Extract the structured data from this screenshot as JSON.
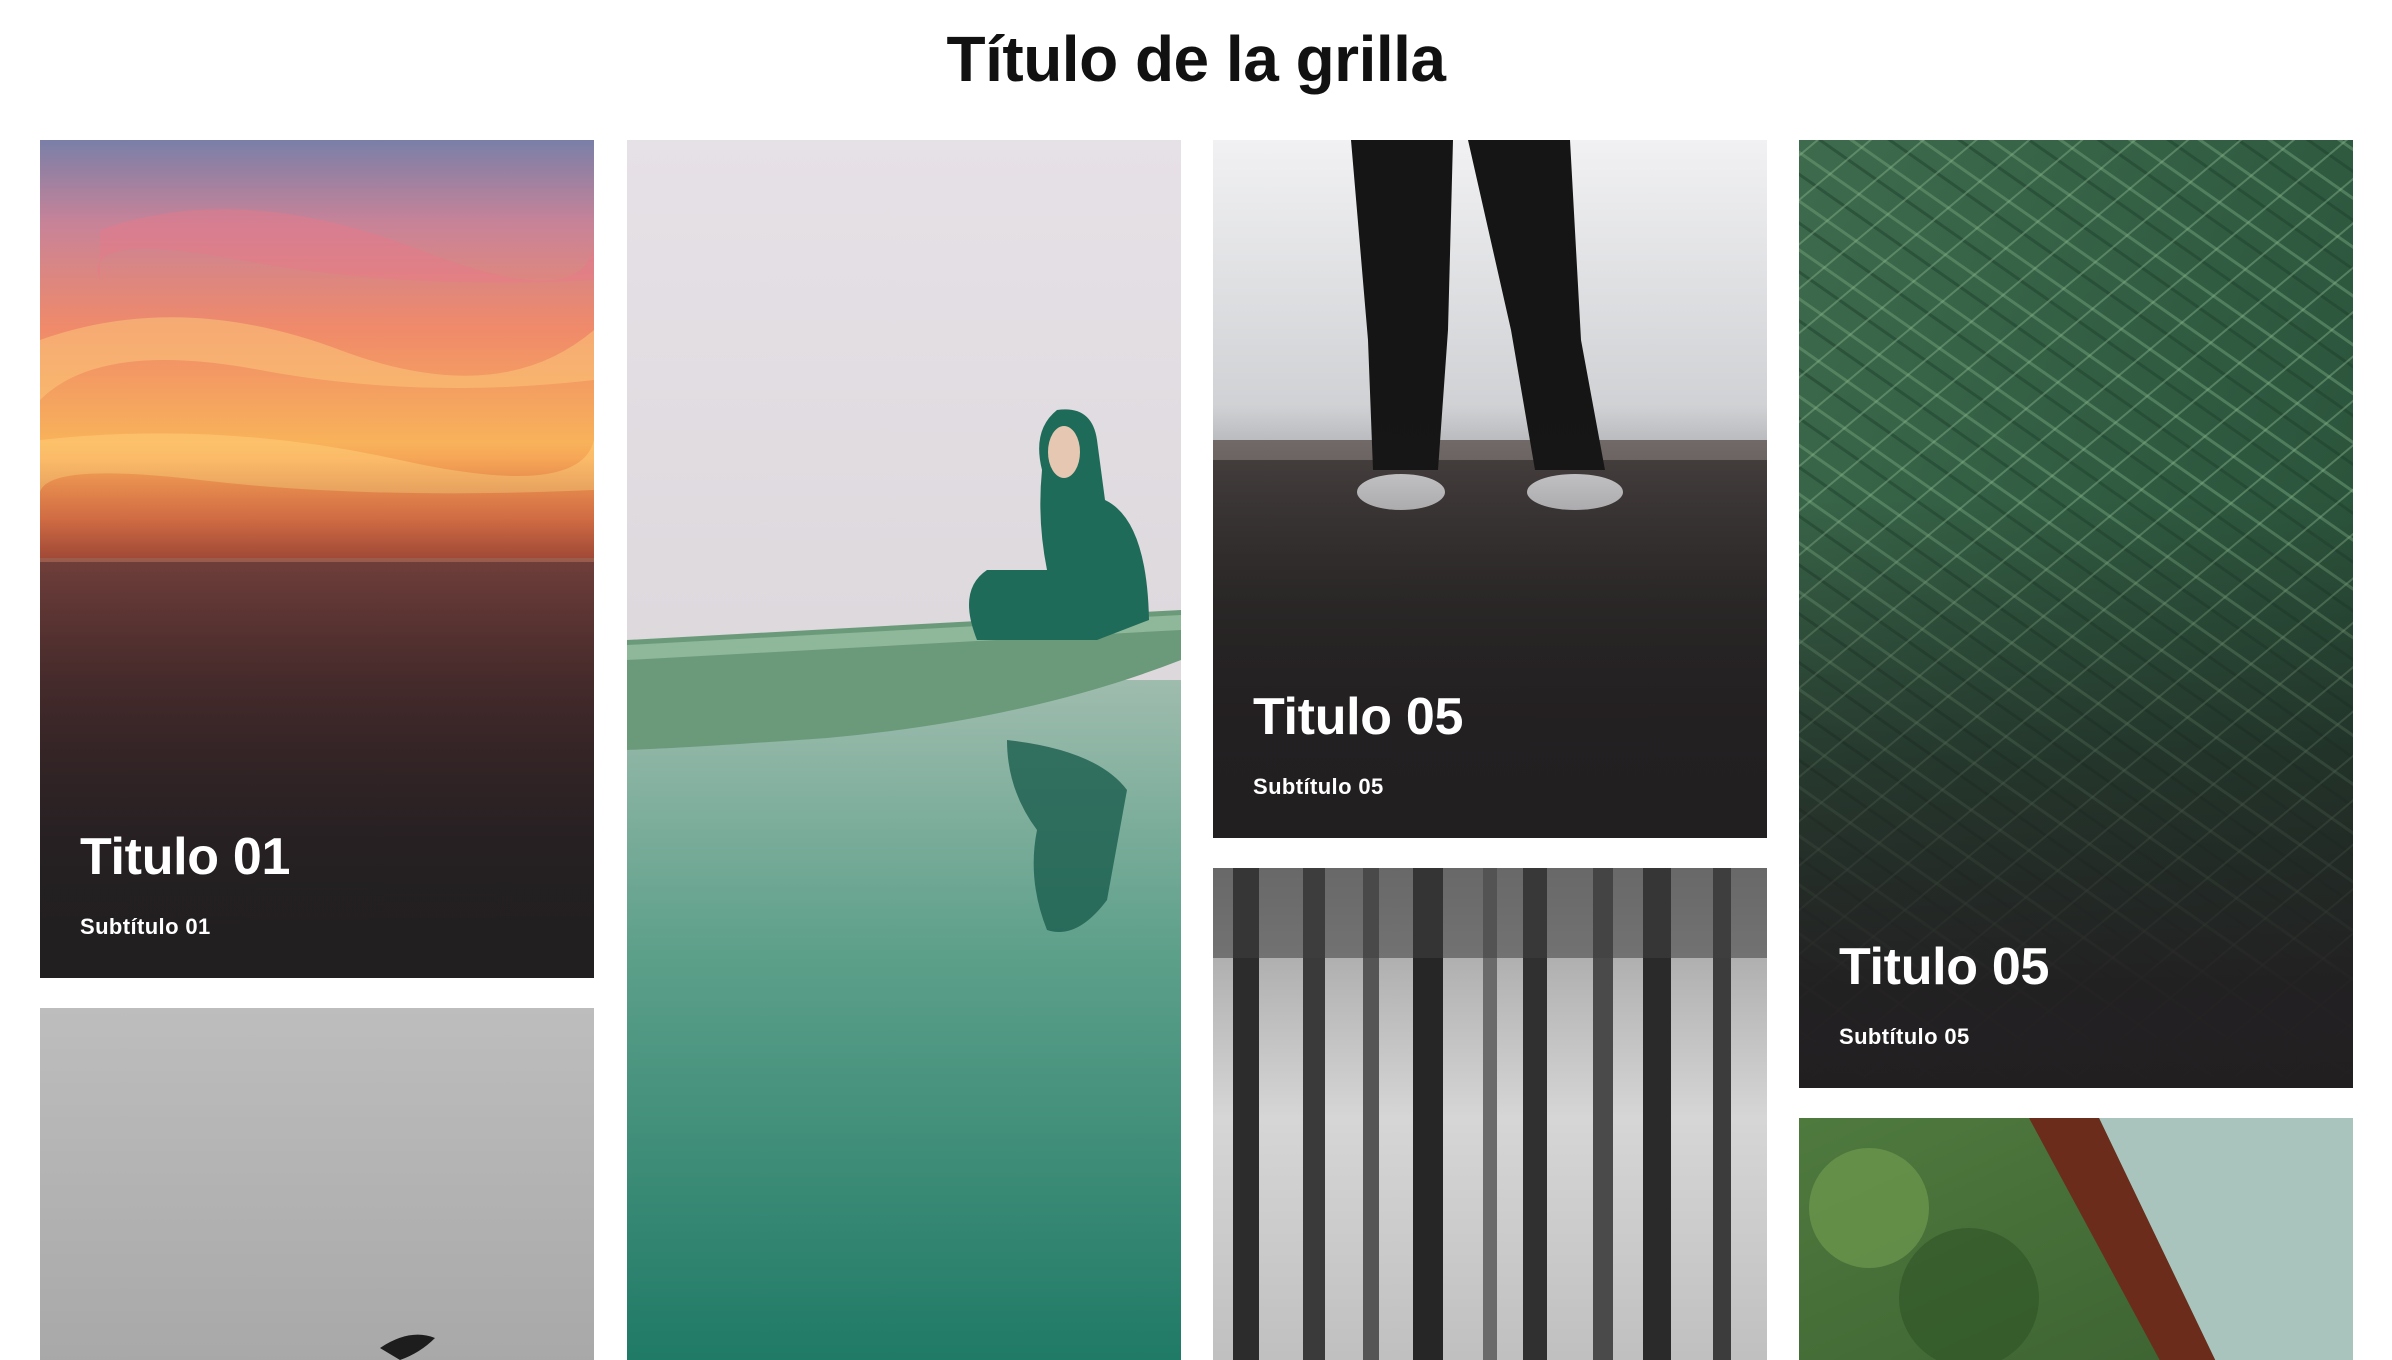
{
  "page": {
    "title": "Título de la grilla"
  },
  "cards": [
    {
      "id": "sunset",
      "title": "Titulo 01",
      "subtitle": "Subtítulo 01",
      "image": "sunset-over-sea"
    },
    {
      "id": "canoe",
      "image": "person-in-canoe-on-lake"
    },
    {
      "id": "legs",
      "title": "Titulo 05",
      "subtitle": "Subtítulo 05",
      "image": "legs-standing-on-rocky-shore"
    },
    {
      "id": "pine",
      "title": "Titulo 05",
      "subtitle": "Subtítulo 05",
      "image": "pine-branches"
    },
    {
      "id": "bird",
      "image": "bird-in-grey-sky"
    },
    {
      "id": "forest",
      "image": "misty-forest-trees"
    },
    {
      "id": "cabin",
      "image": "trees-and-roof"
    }
  ],
  "colors": {
    "background": "#ffffff",
    "title": "#111111",
    "card_text": "#ffffff",
    "overlay": "#221f21"
  }
}
